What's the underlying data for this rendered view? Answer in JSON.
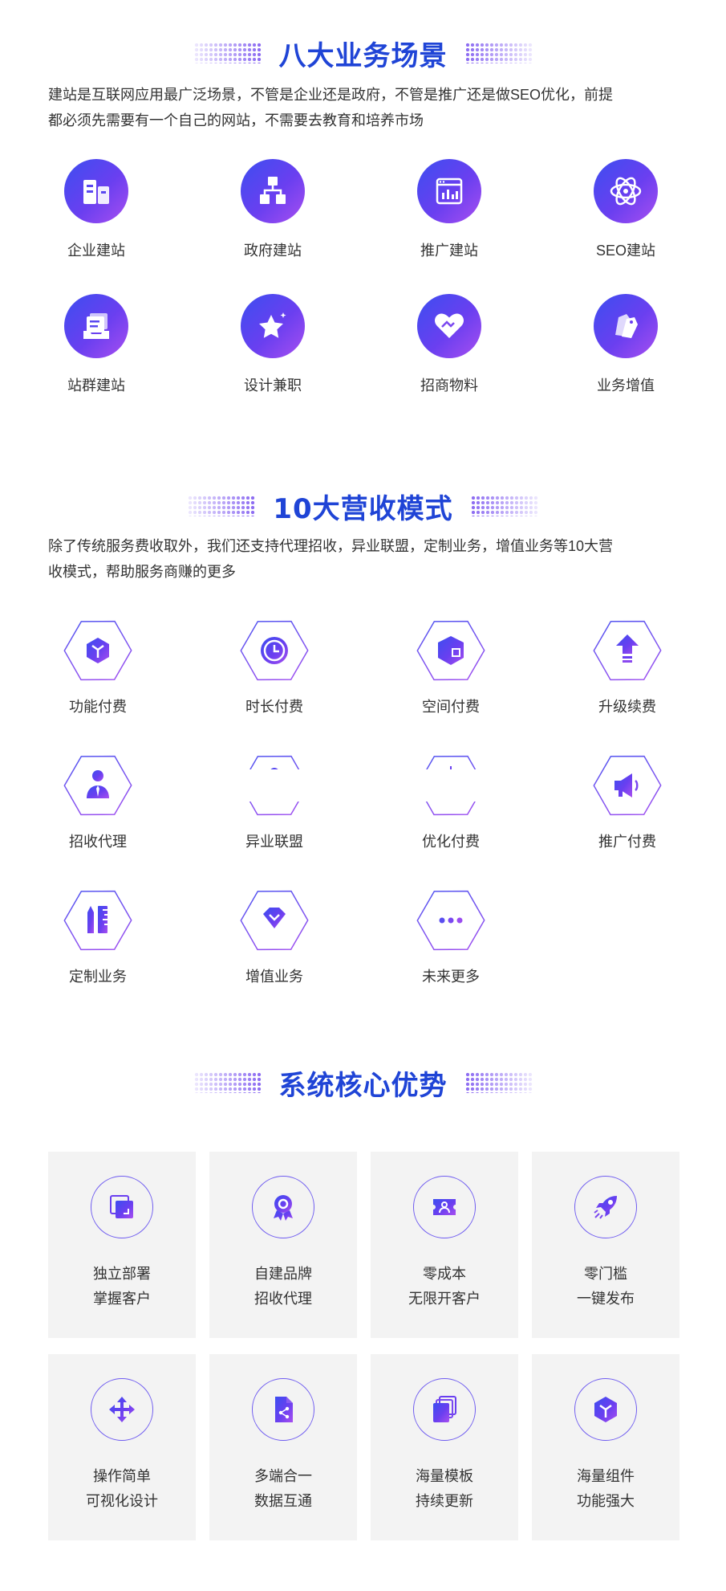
{
  "colors": {
    "title": "#1f44d6",
    "accent_start": "#3c4ef0",
    "accent_end": "#a84ff0",
    "card_bg": "#f3f3f3"
  },
  "section1": {
    "title": "八大业务场景",
    "desc_line1": "建站是互联网应用最广泛场景，不管是企业还是政府，不管是推广还是做SEO优化，前提",
    "desc_line2": "都必须先需要有一个自己的网站，不需要去教育和培养市场",
    "items": [
      {
        "label": "企业建站",
        "icon": "building-icon"
      },
      {
        "label": "政府建站",
        "icon": "org-chart-icon"
      },
      {
        "label": "推广建站",
        "icon": "browser-chart-icon"
      },
      {
        "label": "SEO建站",
        "icon": "atom-icon"
      },
      {
        "label": "站群建站",
        "icon": "stacked-docs-icon"
      },
      {
        "label": "设计兼职",
        "icon": "star-icon"
      },
      {
        "label": "招商物料",
        "icon": "heart-hands-icon"
      },
      {
        "label": "业务增值",
        "icon": "price-tags-icon"
      }
    ]
  },
  "section2": {
    "title": "10大营收模式",
    "desc_line1": "除了传统服务费收取外，我们还支持代理招收，异业联盟，定制业务，增值业务等10大营",
    "desc_line2": "收模式，帮助服务商赚的更多",
    "items": [
      {
        "label": "功能付费",
        "icon": "cube-y-icon"
      },
      {
        "label": "时长付费",
        "icon": "clock-icon"
      },
      {
        "label": "空间付费",
        "icon": "box-icon"
      },
      {
        "label": "升级续费",
        "icon": "arrow-up-icon"
      },
      {
        "label": "招收代理",
        "icon": "agent-icon"
      },
      {
        "label": "异业联盟",
        "icon": "alliance-icon"
      },
      {
        "label": "优化付费",
        "icon": "optimize-icon"
      },
      {
        "label": "推广付费",
        "icon": "megaphone-icon"
      },
      {
        "label": "定制业务",
        "icon": "pencil-ruler-icon"
      },
      {
        "label": "增值业务",
        "icon": "diamond-icon"
      },
      {
        "label": "未来更多",
        "icon": "more-dots-icon"
      }
    ]
  },
  "section3": {
    "title": "系统核心优势",
    "items": [
      {
        "line1": "独立部署",
        "line2": "掌握客户",
        "icon": "layers-icon"
      },
      {
        "line1": "自建品牌",
        "line2": "招收代理",
        "icon": "badge-icon"
      },
      {
        "line1": "零成本",
        "line2": "无限开客户",
        "icon": "ticket-user-icon"
      },
      {
        "line1": "零门槛",
        "line2": "一键发布",
        "icon": "rocket-icon"
      },
      {
        "line1": "操作简单",
        "line2": "可视化设计",
        "icon": "move-icon"
      },
      {
        "line1": "多端合一",
        "line2": "数据互通",
        "icon": "share-doc-icon"
      },
      {
        "line1": "海量模板",
        "line2": "持续更新",
        "icon": "stacked-pages-icon"
      },
      {
        "line1": "海量组件",
        "line2": "功能强大",
        "icon": "cube-icon"
      }
    ]
  }
}
